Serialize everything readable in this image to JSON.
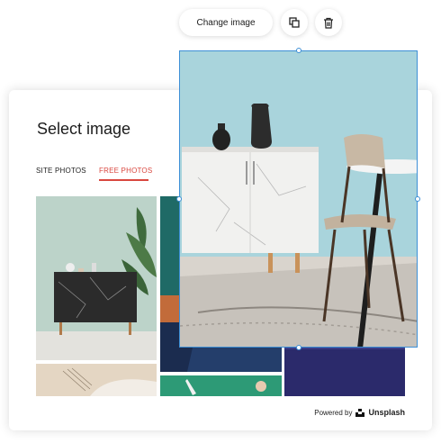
{
  "toolbar": {
    "change_image_label": "Change image",
    "duplicate_icon": "duplicate-icon",
    "delete_icon": "trash-icon"
  },
  "dialog": {
    "title": "Select image",
    "tabs": [
      {
        "label": "SITE PHOTOS",
        "active": false
      },
      {
        "label": "FREE PHOTOS",
        "active": true
      }
    ],
    "footer": {
      "powered_by": "Powered by",
      "brand": "Unsplash"
    }
  },
  "colors": {
    "accent": "#d9473f",
    "selection": "#3d8fd6"
  }
}
